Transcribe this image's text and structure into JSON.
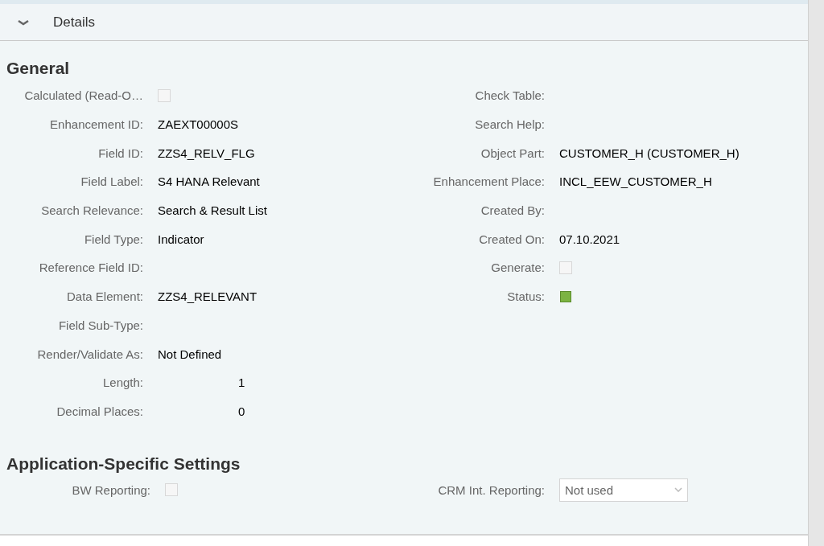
{
  "panel": {
    "title": "Details",
    "expanded": true
  },
  "general": {
    "heading": "General",
    "left": [
      {
        "kind": "checkbox",
        "label": "Calculated (Read-O…",
        "checked": false
      },
      {
        "kind": "text",
        "label": "Enhancement ID:",
        "value": "ZAEXT00000S"
      },
      {
        "kind": "text",
        "label": "Field ID:",
        "value": "ZZS4_RELV_FLG"
      },
      {
        "kind": "text",
        "label": "Field Label:",
        "value": "S4 HANA Relevant"
      },
      {
        "kind": "text",
        "label": "Search Relevance:",
        "value": "Search & Result List"
      },
      {
        "kind": "text",
        "label": "Field Type:",
        "value": "Indicator"
      },
      {
        "kind": "text",
        "label": "Reference Field ID:"
      },
      {
        "kind": "text",
        "label": "Data Element:",
        "value": "ZZS4_RELEVANT"
      },
      {
        "kind": "text",
        "label": "Field Sub-Type:"
      },
      {
        "kind": "text",
        "label": "Render/Validate As:",
        "value": "Not Defined"
      },
      {
        "kind": "number",
        "label": "Length:",
        "value": "1"
      },
      {
        "kind": "number",
        "label": "Decimal Places:",
        "value": "0"
      }
    ],
    "right": [
      {
        "kind": "text",
        "label": "Check Table:"
      },
      {
        "kind": "text",
        "label": "Search Help:"
      },
      {
        "kind": "text",
        "label": "Object Part:",
        "value": "CUSTOMER_H (CUSTOMER_H)"
      },
      {
        "kind": "text",
        "label": "Enhancement Place:",
        "value": "INCL_EEW_CUSTOMER_H"
      },
      {
        "kind": "text",
        "label": "Created By:"
      },
      {
        "kind": "text",
        "label": "Created On:",
        "value": "07.10.2021"
      },
      {
        "kind": "checkbox",
        "label": "Generate:",
        "checked": false
      },
      {
        "kind": "status",
        "label": "Status:",
        "color": "#7cb342"
      }
    ]
  },
  "application": {
    "heading": "Application-Specific Settings",
    "left": [
      {
        "kind": "checkbox",
        "label": "BW Reporting:",
        "checked": false
      }
    ],
    "right": [
      {
        "kind": "select",
        "label": "CRM Int. Reporting:",
        "value": "Not used"
      }
    ]
  }
}
